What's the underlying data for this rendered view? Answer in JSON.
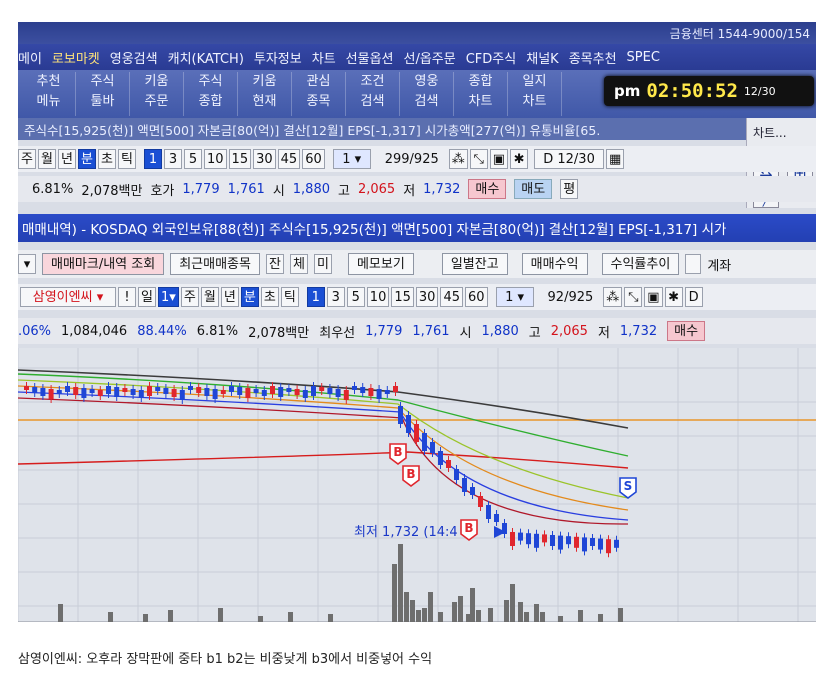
{
  "topbar": {
    "center": "금융센터 1544-9000/154"
  },
  "menu": [
    {
      "label": "메이",
      "hl": false
    },
    {
      "label": "로보마켓",
      "hl": true
    },
    {
      "label": "영웅검색",
      "hl": false
    },
    {
      "label": "캐치(KATCH)",
      "hl": false
    },
    {
      "label": "투자정보",
      "hl": false
    },
    {
      "label": "차트",
      "hl": false
    },
    {
      "label": "선물옵션",
      "hl": false
    },
    {
      "label": "선/옵주문",
      "hl": false
    },
    {
      "label": "CFD주식",
      "hl": false
    },
    {
      "label": "채널K",
      "hl": false
    },
    {
      "label": "종목추천",
      "hl": false
    },
    {
      "label": "SPEC",
      "hl": false
    }
  ],
  "toolbar": [
    {
      "l1": "추천",
      "l2": "메뉴"
    },
    {
      "l1": "주식",
      "l2": "툴바"
    },
    {
      "l1": "키움",
      "l2": "주문"
    },
    {
      "l1": "주식",
      "l2": "종합"
    },
    {
      "l1": "키움",
      "l2": "현재"
    },
    {
      "l1": "관심",
      "l2": "종목"
    },
    {
      "l1": "조건",
      "l2": "검색"
    },
    {
      "l1": "영웅",
      "l2": "검색"
    },
    {
      "l1": "종합",
      "l2": "차트"
    },
    {
      "l1": "일지",
      "l2": "차트"
    }
  ],
  "clock": {
    "ampm": "pm",
    "time": "02:50:52",
    "date": "12/30"
  },
  "info1": "주식수[15,925(천)] 액면[500] 자본금[80(억)] 결산[12월] EPS[-1,317] 시가총액[277(억)] 유통비율[65.",
  "side": {
    "title": "차트..."
  },
  "periods1": {
    "units": [
      "주",
      "월",
      "년",
      "분",
      "초",
      "틱"
    ],
    "nums": [
      "1",
      "3",
      "5",
      "10",
      "15",
      "30",
      "45",
      "60"
    ],
    "sel": "1",
    "count": "299/925",
    "date": "12/30"
  },
  "quote1": {
    "pct1": "6.81%",
    "amount": "2,078백만",
    "label": "호가",
    "p1": "1,779",
    "p2": "1,761",
    "open_label": "시",
    "open": "1,880",
    "high_label": "고",
    "high": "2,065",
    "low_label": "저",
    "low": "1,732",
    "buy": "매수",
    "sell": "매도",
    "eval": "평"
  },
  "title2": "매매내역) - KOSDAQ 외국인보유[88(천)] 주식수[15,925(천)] 액면[500] 자본금[80(억)] 결산[12월] EPS[-1,317] 시가",
  "actions": {
    "mark": "매매마크/내역 조회",
    "recent": "최근매매종목",
    "b1": "잔",
    "b2": "체",
    "b3": "미",
    "memo": "메모보기",
    "daily": "일별잔고",
    "profit": "매매수익",
    "profit_rate": "수익률추이",
    "calc": "계좌"
  },
  "periods2": {
    "stock": "삼영이엔씨",
    "excl": "!",
    "day": "일",
    "units": [
      "주",
      "월",
      "년",
      "분",
      "초",
      "틱"
    ],
    "nums": [
      "1",
      "3",
      "5",
      "10",
      "15",
      "30",
      "45",
      "60"
    ],
    "sel": "1",
    "count": "92/925",
    "d": "D"
  },
  "quote2": {
    "pct0": ".06%",
    "vol": "1,084,046",
    "pct2": "88.44%",
    "pct1": "6.81%",
    "amount": "2,078백만",
    "label": "최우선",
    "p1": "1,779",
    "p2": "1,761",
    "open_label": "시",
    "open": "1,880",
    "high_label": "고",
    "high": "2,065",
    "low_label": "저",
    "low": "1,732",
    "buy": "매수"
  },
  "chart_annot": {
    "low_text": "최저 1,732 (14:4",
    "b1": "B",
    "b2": "B",
    "b3": "B",
    "s": "S"
  },
  "colors": {
    "up": "#e0262d",
    "down": "#1f46d6",
    "ma_green": "#2fae2f",
    "ma_orange": "#e38a1c",
    "ma_gray": "#3b3b3b",
    "ma_red": "#d61d1d",
    "ma_blue": "#2a3fe0"
  },
  "caption": "삼영이엔씨:  오후라 장막판에 중타 b1  b2는 비중낮게 b3에서 비중넣어 수익"
}
